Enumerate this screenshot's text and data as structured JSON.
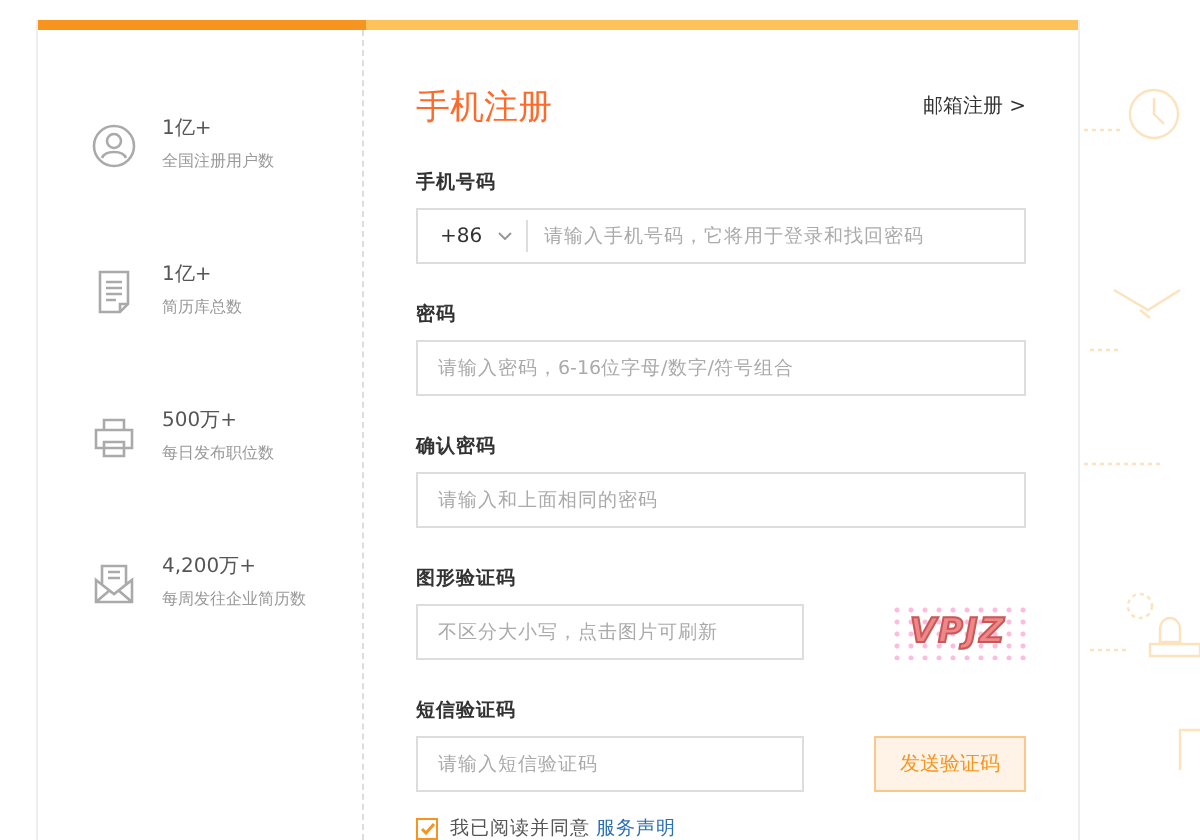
{
  "stats": [
    {
      "value": "1亿+",
      "label": "全国注册用户数"
    },
    {
      "value": "1亿+",
      "label": "简历库总数"
    },
    {
      "value": "500万+",
      "label": "每日发布职位数"
    },
    {
      "value": "4,200万+",
      "label": "每周发往企业简历数"
    }
  ],
  "form": {
    "title": "手机注册",
    "switch_link": "邮箱注册 >",
    "fields": [
      {
        "kind": "phone",
        "label": "手机号码",
        "country_code": "+86",
        "placeholder": "请输入手机号码，它将用于登录和找回密码"
      },
      {
        "kind": "text",
        "label": "密码",
        "placeholder": "请输入密码，6-16位字母/数字/符号组合"
      },
      {
        "kind": "text",
        "label": "确认密码",
        "placeholder": "请输入和上面相同的密码"
      },
      {
        "kind": "captcha",
        "label": "图形验证码",
        "placeholder": "不区分大小写，点击图片可刷新",
        "captcha_text": "VPJZ"
      },
      {
        "kind": "sms",
        "label": "短信验证码",
        "placeholder": "请输入短信验证码",
        "button": "发送验证码"
      }
    ],
    "agreement": {
      "checked": true,
      "text": "我已阅读并同意",
      "link": "服务声明"
    }
  }
}
